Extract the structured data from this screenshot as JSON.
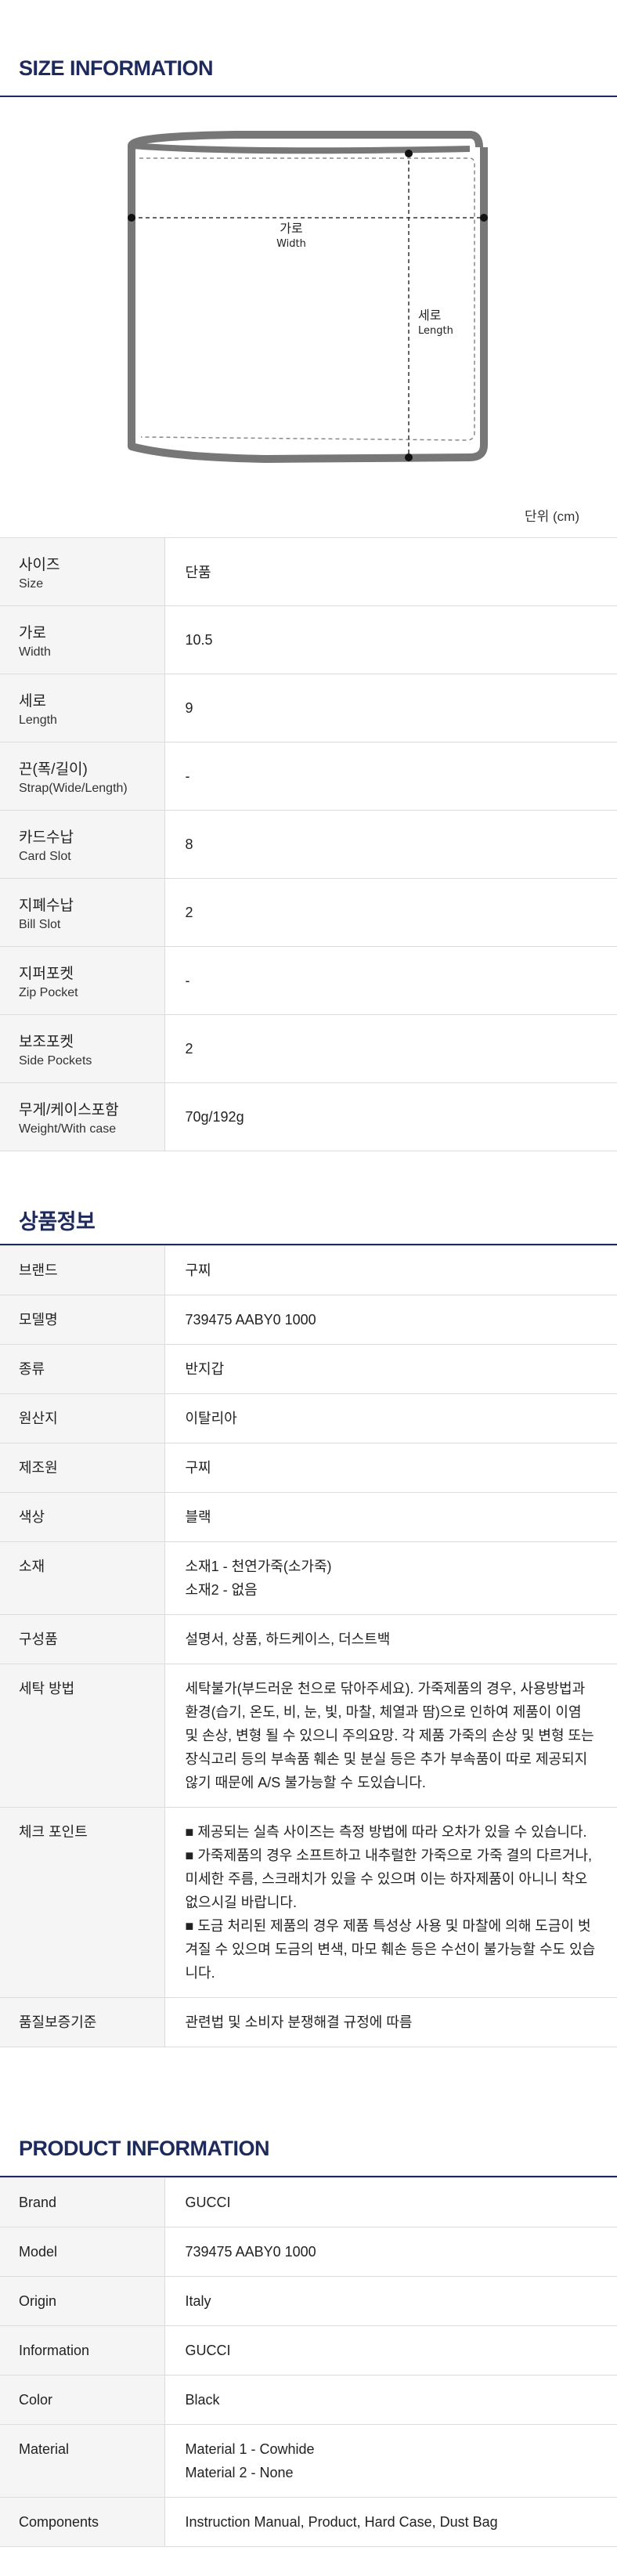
{
  "size_info": {
    "title": "SIZE INFORMATION",
    "diagram": {
      "width_ko": "가로",
      "width_en": "Width",
      "length_ko": "세로",
      "length_en": "Length"
    },
    "unit": "단위 (cm)",
    "rows": [
      {
        "ko": "사이즈",
        "en": "Size",
        "value": "단품"
      },
      {
        "ko": "가로",
        "en": "Width",
        "value": "10.5"
      },
      {
        "ko": "세로",
        "en": "Length",
        "value": "9"
      },
      {
        "ko": "끈(폭/길이)",
        "en": "Strap(Wide/Length)",
        "value": "-"
      },
      {
        "ko": "카드수납",
        "en": "Card Slot",
        "value": "8"
      },
      {
        "ko": "지폐수납",
        "en": "Bill Slot",
        "value": "2"
      },
      {
        "ko": "지퍼포켓",
        "en": "Zip Pocket",
        "value": "-"
      },
      {
        "ko": "보조포켓",
        "en": "Side Pockets",
        "value": "2"
      },
      {
        "ko": "무게/케이스포함",
        "en": "Weight/With case",
        "value": "70g/192g"
      }
    ]
  },
  "product_ko": {
    "title": "상품정보",
    "rows": [
      {
        "key": "브랜드",
        "value": [
          "구찌"
        ]
      },
      {
        "key": "모델명",
        "value": [
          "739475 AABY0 1000"
        ]
      },
      {
        "key": "종류",
        "value": [
          "반지갑"
        ]
      },
      {
        "key": "원산지",
        "value": [
          "이탈리아"
        ]
      },
      {
        "key": "제조원",
        "value": [
          "구찌"
        ]
      },
      {
        "key": "색상",
        "value": [
          "블랙"
        ]
      },
      {
        "key": "소재",
        "value": [
          "소재1 - 천연가죽(소가죽)",
          "소재2 - 없음"
        ]
      },
      {
        "key": "구성품",
        "value": [
          "설명서, 상품, 하드케이스, 더스트백"
        ]
      },
      {
        "key": "세탁 방법",
        "value": [
          "세탁불가(부드러운 천으로 닦아주세요). 가죽제품의 경우, 사용방법과 환경(습기, 온도, 비, 눈, 빛, 마찰, 체열과 땀)으로 인하여 제품이 이염 및 손상, 변형 될 수 있으니 주의요망. 각 제품 가죽의 손상 및 변형 또는 장식고리 등의 부속품 훼손 및 분실 등은 추가 부속품이 따로 제공되지 않기 때문에 A/S 불가능할 수 도있습니다."
        ]
      },
      {
        "key": "체크 포인트",
        "value": [
          "■ 제공되는 실측 사이즈는 측정 방법에 따라 오차가 있을 수 있습니다.",
          "■ 가죽제품의 경우 소프트하고 내추럴한 가죽으로 가죽 결의 다르거나, 미세한 주름, 스크래치가 있을 수 있으며 이는 하자제품이 아니니 착오 없으시길 바랍니다.",
          "■ 도금 처리된 제품의 경우 제품 특성상 사용 및 마찰에 의해 도금이 벗겨질 수 있으며 도금의 변색, 마모 훼손 등은 수선이 불가능할 수도 있습니다."
        ]
      },
      {
        "key": "품질보증기준",
        "value": [
          "관련법 및 소비자 분쟁해결 규정에 따름"
        ]
      }
    ]
  },
  "product_en": {
    "title": "PRODUCT INFORMATION",
    "rows": [
      {
        "key": "Brand",
        "value": [
          "GUCCI"
        ]
      },
      {
        "key": "Model",
        "value": [
          "739475 AABY0 1000"
        ]
      },
      {
        "key": "Origin",
        "value": [
          "Italy"
        ]
      },
      {
        "key": "Information",
        "value": [
          "GUCCI"
        ]
      },
      {
        "key": "Color",
        "value": [
          "Black"
        ]
      },
      {
        "key": "Material",
        "value": [
          "Material 1 - Cowhide",
          "Material 2 - None"
        ]
      },
      {
        "key": "Components",
        "value": [
          "Instruction Manual, Product, Hard Case, Dust Bag"
        ]
      }
    ]
  }
}
